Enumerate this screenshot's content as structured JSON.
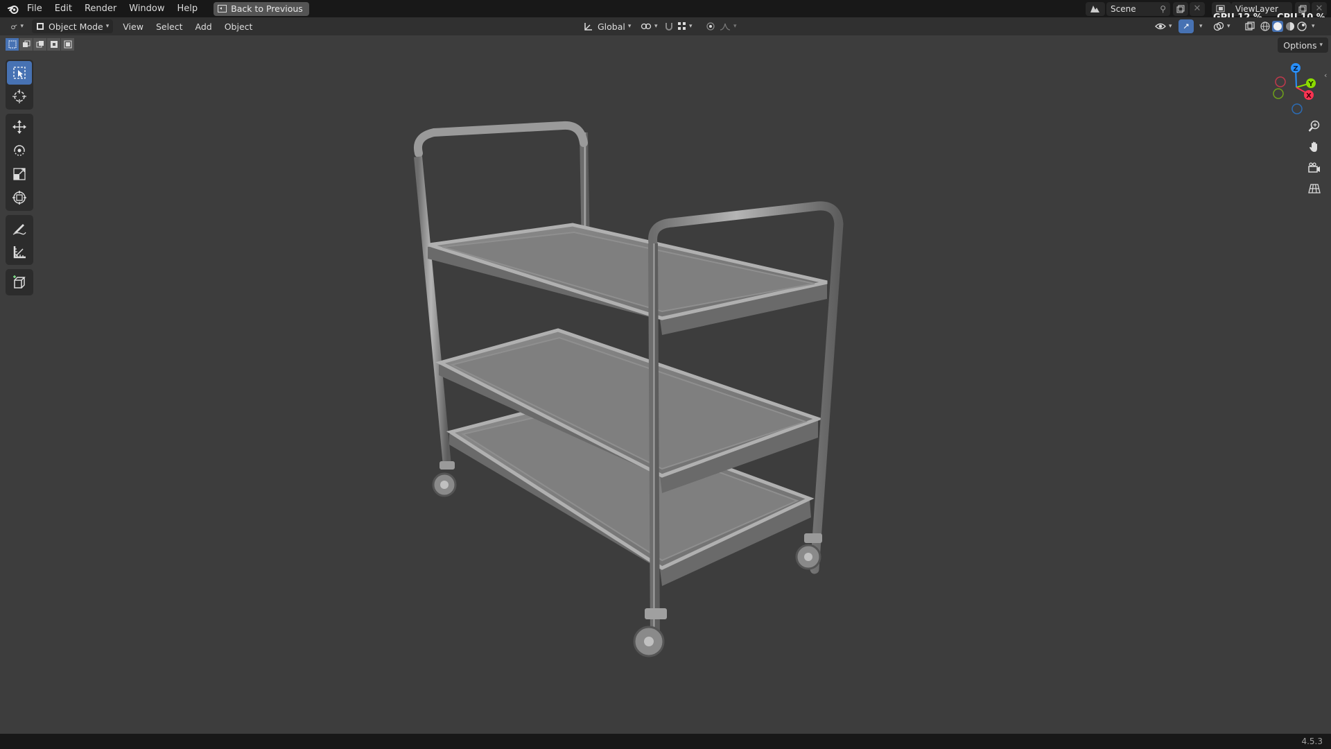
{
  "topbar": {
    "menus": [
      "File",
      "Edit",
      "Render",
      "Window",
      "Help"
    ],
    "back_label": "Back to Previous",
    "scene": "Scene",
    "view_layer": "ViewLayer",
    "gpu_label": "GPU",
    "gpu_value": "12 %",
    "cpu_label": "CPU",
    "cpu_value": "10 %"
  },
  "header": {
    "mode": "Object Mode",
    "menus": [
      "View",
      "Select",
      "Add",
      "Object"
    ],
    "orientation": "Global",
    "options_label": "Options"
  },
  "toolbar": {
    "tools": [
      "select-box",
      "cursor",
      "move",
      "rotate",
      "scale",
      "transform",
      "annotate",
      "measure",
      "add-cube"
    ],
    "active": "select-box"
  },
  "navigation_gizmo": {
    "axes": [
      "X",
      "Y",
      "Z"
    ]
  },
  "status": {
    "version": "4.5.3"
  },
  "colors": {
    "accent": "#4772b3",
    "background": "#3d3d3d",
    "x_axis": "#ff3352",
    "y_axis": "#8bdc00",
    "z_axis": "#2890ff"
  }
}
